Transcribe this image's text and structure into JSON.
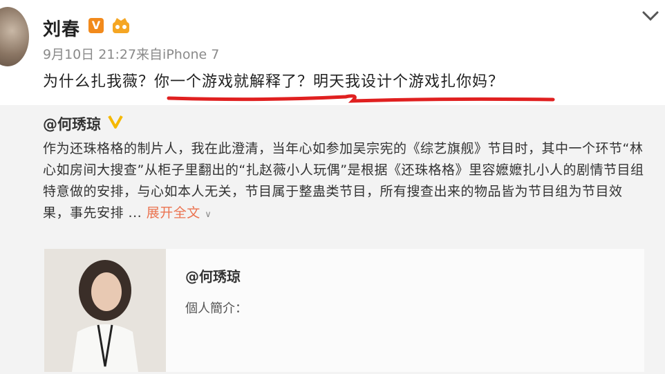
{
  "header": {
    "username": "刘春",
    "verified_badge": "V",
    "meta": "9月10日 21:27来自iPhone 7",
    "post_text": "为什么扎我薇？你一个游戏就解释了？明天我设计个游戏扎你妈？"
  },
  "repost": {
    "user": "@何琇琼",
    "text": "作为还珠格格的制片人，我在此澄清，当年心如参加吴宗宪的《综艺旗舰》节目时，其中一个环节“林心如房间大搜查”从柜子里翻出的“扎赵薇小人玩偶”是根据《还珠格格》里容嬷嬷扎小人的剧情节目组特意做的安排，与心如本人无关，节目属于整蛊类节目，所有搜查出来的物品皆为节目组为节目效果，事先安排 ...",
    "expand_label": "展开全文",
    "expand_icon": "chevron-down-icon"
  },
  "card": {
    "name": "@何琇琼",
    "bio": "個人簡介："
  },
  "colors": {
    "accent_orange": "#eb7350",
    "badge_orange": "#f28a1c",
    "annotation_red": "#e02020",
    "gold_v": "#f5b800"
  }
}
